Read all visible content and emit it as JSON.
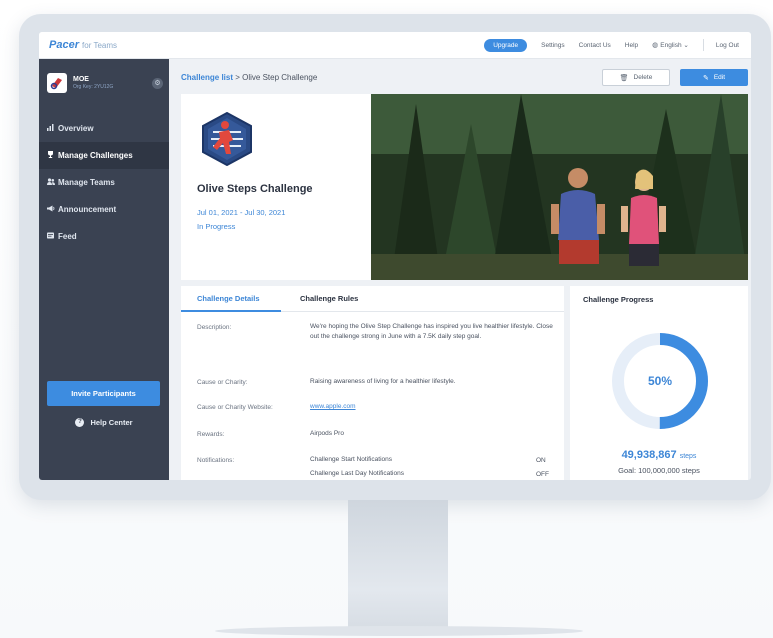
{
  "topbar": {
    "logo": "Pacer",
    "logo_sub": "for Teams",
    "upgrade": "Upgrade",
    "settings": "Settings",
    "contact": "Contact Us",
    "help": "Help",
    "language": "English",
    "logout": "Log Out"
  },
  "sidebar": {
    "org_name": "MOE",
    "org_key": "Org Key: 2YU12G",
    "items": [
      {
        "label": "Overview",
        "icon": "bar-chart-icon"
      },
      {
        "label": "Manage Challenges",
        "icon": "trophy-icon"
      },
      {
        "label": "Manage Teams",
        "icon": "users-icon"
      },
      {
        "label": "Announcement",
        "icon": "megaphone-icon"
      },
      {
        "label": "Feed",
        "icon": "feed-icon"
      }
    ],
    "invite": "Invite Participants",
    "help_center": "Help Center"
  },
  "header": {
    "breadcrumb_link": "Challenge list",
    "breadcrumb_sep": " > ",
    "breadcrumb_current": "Olive Step Challenge",
    "delete": "Delete",
    "edit": "Edit"
  },
  "challenge": {
    "title": "Olive Steps Challenge",
    "dates": "Jul 01, 2021 - Jul 30, 2021",
    "status": "In Progress"
  },
  "details": {
    "tab_details": "Challenge Details",
    "tab_rules": "Challenge Rules",
    "rows": [
      {
        "label": "Description:",
        "value": "We're hoping the Olive Step Challenge has inspired you live healthier lifestyle. Close out the challenge strong in June with a 7.5K daily step goal."
      },
      {
        "label": "Cause or Charity:",
        "value": "Raising awareness of living for a healthier lifestyle."
      },
      {
        "label": "Cause or Charity Website:",
        "value": "www.apple.com"
      },
      {
        "label": "Rewards:",
        "value": "Airpods Pro"
      },
      {
        "label": "Notifications:",
        "value": "Challenge Start Notifications",
        "state": "ON"
      },
      {
        "label": "",
        "value": "Challenge Last Day Notifications",
        "state": "OFF"
      }
    ]
  },
  "progress": {
    "title": "Challenge Progress",
    "percent_label": "50%",
    "fraction": 0.5,
    "steps": "49,938,867",
    "steps_unit": "steps",
    "goal": "Goal: 100,000,000 steps"
  },
  "colors": {
    "accent": "#3d8ce0",
    "sidebar": "#3a4252",
    "ring_track": "#e6eef8"
  }
}
